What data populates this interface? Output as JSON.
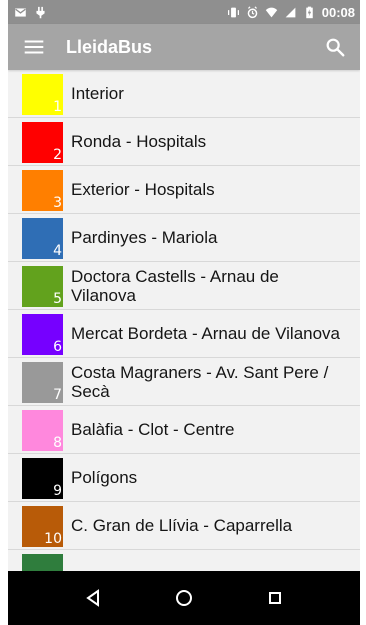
{
  "status_bar": {
    "time": "00:08",
    "left_icons": [
      "mail-icon",
      "usb-icon"
    ],
    "right_icons": [
      "vibrate-icon",
      "alarm-icon",
      "wifi-icon",
      "signal-icon",
      "battery-icon"
    ]
  },
  "app_bar": {
    "title": "LleidaBus",
    "menu_icon": "menu-icon",
    "search_icon": "search-icon"
  },
  "routes": [
    {
      "number": "1",
      "name": "Interior",
      "color": "#ffff00"
    },
    {
      "number": "2",
      "name": "Ronda - Hospitals",
      "color": "#ff0000"
    },
    {
      "number": "3",
      "name": "Exterior - Hospitals",
      "color": "#ff7f00"
    },
    {
      "number": "4",
      "name": "Pardinyes - Mariola",
      "color": "#2f6eb5"
    },
    {
      "number": "5",
      "name": "Doctora Castells - Arnau de Vilanova",
      "color": "#62a21d"
    },
    {
      "number": "6",
      "name": "Mercat Bordeta - Arnau de Vilanova",
      "color": "#7600ff"
    },
    {
      "number": "7",
      "name": "Costa Magraners - Av. Sant Pere / Secà",
      "color": "#999999"
    },
    {
      "number": "8",
      "name": "Balàfia - Clot - Centre",
      "color": "#ff88dd"
    },
    {
      "number": "9",
      "name": "Polígons",
      "color": "#000000"
    },
    {
      "number": "10",
      "name": "C. Gran de Llívia - Caparrella",
      "color": "#b85b08"
    },
    {
      "number": "",
      "name": "",
      "color": "#2f7d3d"
    }
  ],
  "navigation": {
    "back_icon": "back-triangle-icon",
    "home_icon": "home-circle-icon",
    "recents_icon": "recents-square-icon"
  }
}
